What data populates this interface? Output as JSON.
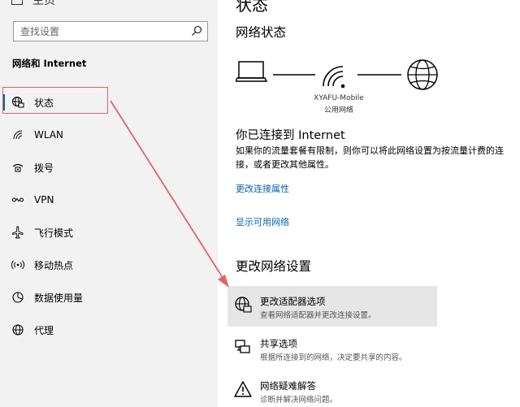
{
  "sidebar": {
    "home_label": "主页",
    "search_placeholder": "查找设置",
    "section_title": "网络和 Internet",
    "items": [
      {
        "label": "状态",
        "icon": "globe-network-icon"
      },
      {
        "label": "WLAN",
        "icon": "wifi-icon"
      },
      {
        "label": "拨号",
        "icon": "dialup-icon"
      },
      {
        "label": "VPN",
        "icon": "vpn-icon"
      },
      {
        "label": "飞行模式",
        "icon": "airplane-icon"
      },
      {
        "label": "移动热点",
        "icon": "hotspot-icon"
      },
      {
        "label": "数据使用量",
        "icon": "data-usage-icon"
      },
      {
        "label": "代理",
        "icon": "globe-icon"
      }
    ]
  },
  "main": {
    "page_title": "状态",
    "network_status_heading": "网络状态",
    "network_name": "XYAFU-Mobile",
    "network_type": "公用网络",
    "connected_heading": "你已连接到 Internet",
    "description": "如果你的流量套餐有限制，则你可以将此网络设置为按流量计费的连接，或者更改其他属性。",
    "link_change_props": "更改连接属性",
    "link_show_networks": "显示可用网络",
    "change_settings_heading": "更改网络设置",
    "options": [
      {
        "title": "更改适配器选项",
        "subtitle": "查看网络适配器并更改连接设置。"
      },
      {
        "title": "共享选项",
        "subtitle": "根据所连接到的网络，决定要共享的内容。"
      },
      {
        "title": "网络疑难解答",
        "subtitle": "诊断并解决网络问题。"
      }
    ]
  },
  "colors": {
    "accent": "#0063b1",
    "annotation": "#e06464",
    "sidebar_bg": "#f2f2f2"
  }
}
